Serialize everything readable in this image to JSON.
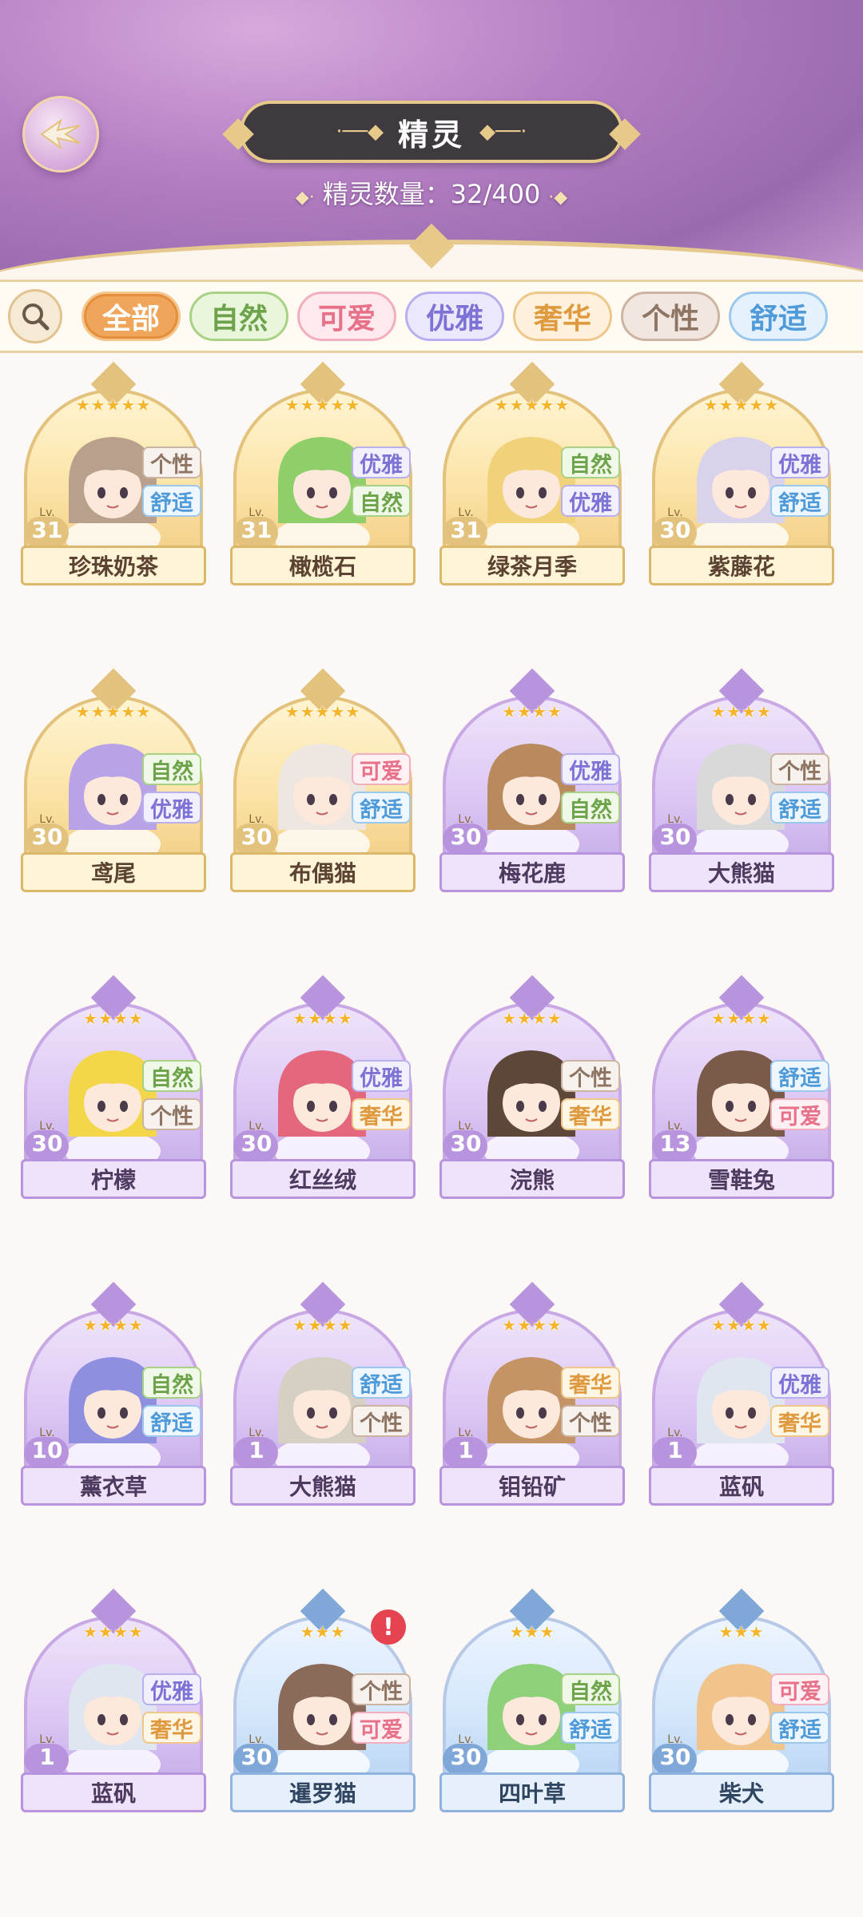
{
  "header": {
    "title": "精灵",
    "count_label": "精灵数量：",
    "count_value": "32/400"
  },
  "filters": [
    {
      "label": "全部",
      "key": "all",
      "selected": true
    },
    {
      "label": "自然",
      "key": "nature"
    },
    {
      "label": "可爱",
      "key": "cute"
    },
    {
      "label": "优雅",
      "key": "elegant"
    },
    {
      "label": "奢华",
      "key": "luxury"
    },
    {
      "label": "个性",
      "key": "personality"
    },
    {
      "label": "舒适",
      "key": "comfort"
    }
  ],
  "level_prefix": "Lv.",
  "cards": [
    {
      "name": "珍珠奶茶",
      "level": "31",
      "stars": "★★★★★",
      "rarity": "gold",
      "tags": [
        "个性",
        "舒适"
      ],
      "color": "#b9a08c"
    },
    {
      "name": "橄榄石",
      "level": "31",
      "stars": "★★★★★",
      "rarity": "gold",
      "tags": [
        "优雅",
        "自然"
      ],
      "color": "#8fcf6a"
    },
    {
      "name": "绿茶月季",
      "level": "31",
      "stars": "★★★★★",
      "rarity": "gold",
      "tags": [
        "自然",
        "优雅"
      ],
      "color": "#f1d27a"
    },
    {
      "name": "紫藤花",
      "level": "30",
      "stars": "★★★★★",
      "rarity": "gold",
      "tags": [
        "优雅",
        "舒适"
      ],
      "color": "#d8d2ea"
    },
    {
      "name": "鸢尾",
      "level": "30",
      "stars": "★★★★★",
      "rarity": "gold",
      "tags": [
        "自然",
        "优雅"
      ],
      "color": "#b7a3e6"
    },
    {
      "name": "布偶猫",
      "level": "30",
      "stars": "★★★★★",
      "rarity": "gold",
      "tags": [
        "可爱",
        "舒适"
      ],
      "color": "#eee6e0"
    },
    {
      "name": "梅花鹿",
      "level": "30",
      "stars": "★★★★",
      "rarity": "purple",
      "tags": [
        "优雅",
        "自然"
      ],
      "color": "#b98a5e"
    },
    {
      "name": "大熊猫",
      "level": "30",
      "stars": "★★★★",
      "rarity": "purple",
      "tags": [
        "个性",
        "舒适"
      ],
      "color": "#d9d9d9"
    },
    {
      "name": "柠檬",
      "level": "30",
      "stars": "★★★★",
      "rarity": "purple",
      "tags": [
        "自然",
        "个性"
      ],
      "color": "#f3d64a"
    },
    {
      "name": "红丝绒",
      "level": "30",
      "stars": "★★★★",
      "rarity": "purple",
      "tags": [
        "优雅",
        "奢华"
      ],
      "color": "#e4677e"
    },
    {
      "name": "浣熊",
      "level": "30",
      "stars": "★★★★",
      "rarity": "purple",
      "tags": [
        "个性",
        "奢华"
      ],
      "color": "#5e4638"
    },
    {
      "name": "雪鞋兔",
      "level": "13",
      "stars": "★★★★",
      "rarity": "purple",
      "tags": [
        "舒适",
        "可爱"
      ],
      "color": "#7a5a48"
    },
    {
      "name": "薰衣草",
      "level": "10",
      "stars": "★★★★",
      "rarity": "purple",
      "tags": [
        "自然",
        "舒适"
      ],
      "color": "#8f8fe0"
    },
    {
      "name": "大熊猫",
      "level": "1",
      "stars": "★★★★",
      "rarity": "purple",
      "tags": [
        "舒适",
        "个性"
      ],
      "color": "#d6cfc4"
    },
    {
      "name": "钼铅矿",
      "level": "1",
      "stars": "★★★★",
      "rarity": "purple",
      "tags": [
        "奢华",
        "个性"
      ],
      "color": "#c49366"
    },
    {
      "name": "蓝矾",
      "level": "1",
      "stars": "★★★★",
      "rarity": "purple",
      "tags": [
        "优雅",
        "奢华"
      ],
      "color": "#dfe6ef"
    },
    {
      "name": "蓝矾",
      "level": "1",
      "stars": "★★★★",
      "rarity": "purple",
      "tags": [
        "优雅",
        "奢华"
      ],
      "color": "#dfe6ef"
    },
    {
      "name": "暹罗猫",
      "level": "30",
      "stars": "★★★",
      "rarity": "blue",
      "tags": [
        "个性",
        "可爱"
      ],
      "color": "#8a6a58",
      "alert": "!"
    },
    {
      "name": "四叶草",
      "level": "30",
      "stars": "★★★",
      "rarity": "blue",
      "tags": [
        "自然",
        "舒适"
      ],
      "color": "#8fd07a"
    },
    {
      "name": "柴犬",
      "level": "30",
      "stars": "★★★",
      "rarity": "blue",
      "tags": [
        "可爱",
        "舒适"
      ],
      "color": "#f0c48a"
    }
  ]
}
